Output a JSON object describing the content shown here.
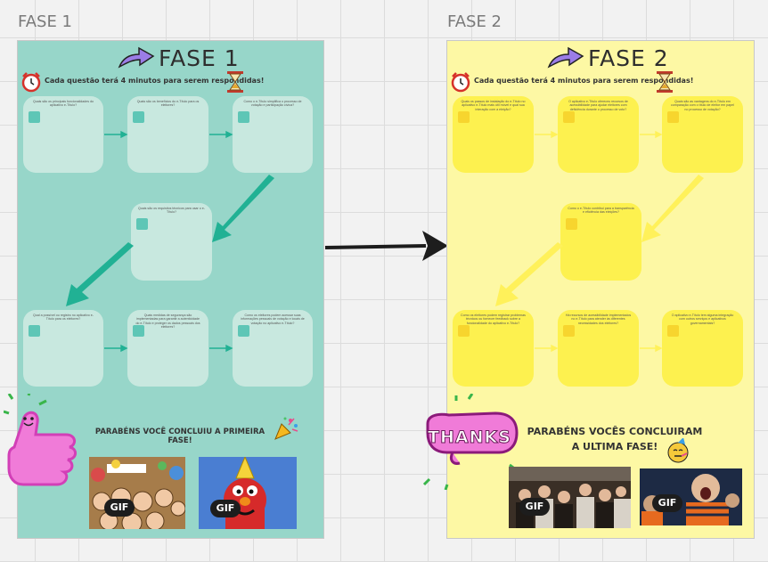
{
  "frames": [
    {
      "label": "FASE 1",
      "title": "FASE 1",
      "subtitle": "Cada questão terá 4 minutos para serem respondidas!",
      "color": "#97d6c9",
      "cards": [
        {
          "text": "Quais são os principais funcionalidades do aplicativo e-Título?"
        },
        {
          "text": "Quais são os benefícios do e-Título para os eleitores?"
        },
        {
          "text": "Como o e-Título simplifica o processo de votação e participação cívica?"
        },
        {
          "text": "Quais são os requisitos técnicos para usar o e-Título?"
        },
        {
          "text": "Qual a possível ou registro no aplicativo e-Título para os eleitores?"
        },
        {
          "text": "Quais medidas de segurança são implementadas para garantir a autenticidade do e-Título e proteger os dados pessoais dos eleitores?"
        },
        {
          "text": "Como os eleitores podem acessar suas informações pessoais de votação e locais de votação no aplicativo e-Título?"
        }
      ],
      "congrats": "PARABÉNS VOCÊ CONCLUIU A PRIMEIRA FASE!",
      "gifs": [
        "GIF",
        "GIF"
      ]
    },
    {
      "label": "FASE 2",
      "title": "FASE 2",
      "subtitle": "Cada questão terá 4 minutos para serem respondidas!",
      "color": "#fdf8a4",
      "cards": [
        {
          "text": "Quais os passos de instalação do e-Título no aplicativo e-Título mais útil móvel e qual sua interação com a eleição?"
        },
        {
          "text": "O aplicativo e-Título ofereceu recursos de acessibilidade para ajudar eleitores com deficiência durante o processo de voto?"
        },
        {
          "text": "Quais são as vantagens do e-Título em comparação com o título de eleitor em papel no processo de votação?"
        },
        {
          "text": "Como o e-Título contribui para a transparência e eficiência das eleições?"
        },
        {
          "text": "Como os eleitores podem registrar problemas técnicos ou fornecer feedback sobre a funcionalidade do aplicativo e-Título?"
        },
        {
          "text": "Há recursos de acessibilidade implementados no e-Título para atender às diferentes necessidades dos eleitores?"
        },
        {
          "text": "O aplicativo e-Título tem alguma integração com outros serviços e aplicativos governamentais?"
        }
      ],
      "congrats": "PARABÉNS VOCÊS CONCLUIRAM A ULTIMA FASE!",
      "gifs": [
        "GIF",
        "GIF"
      ]
    }
  ],
  "stickers": {
    "thanks": "THANKS"
  },
  "colors": {
    "teal_arrow": "#21b194",
    "yellow_arrow": "#fff15a",
    "connector": "#1d1d1d"
  }
}
